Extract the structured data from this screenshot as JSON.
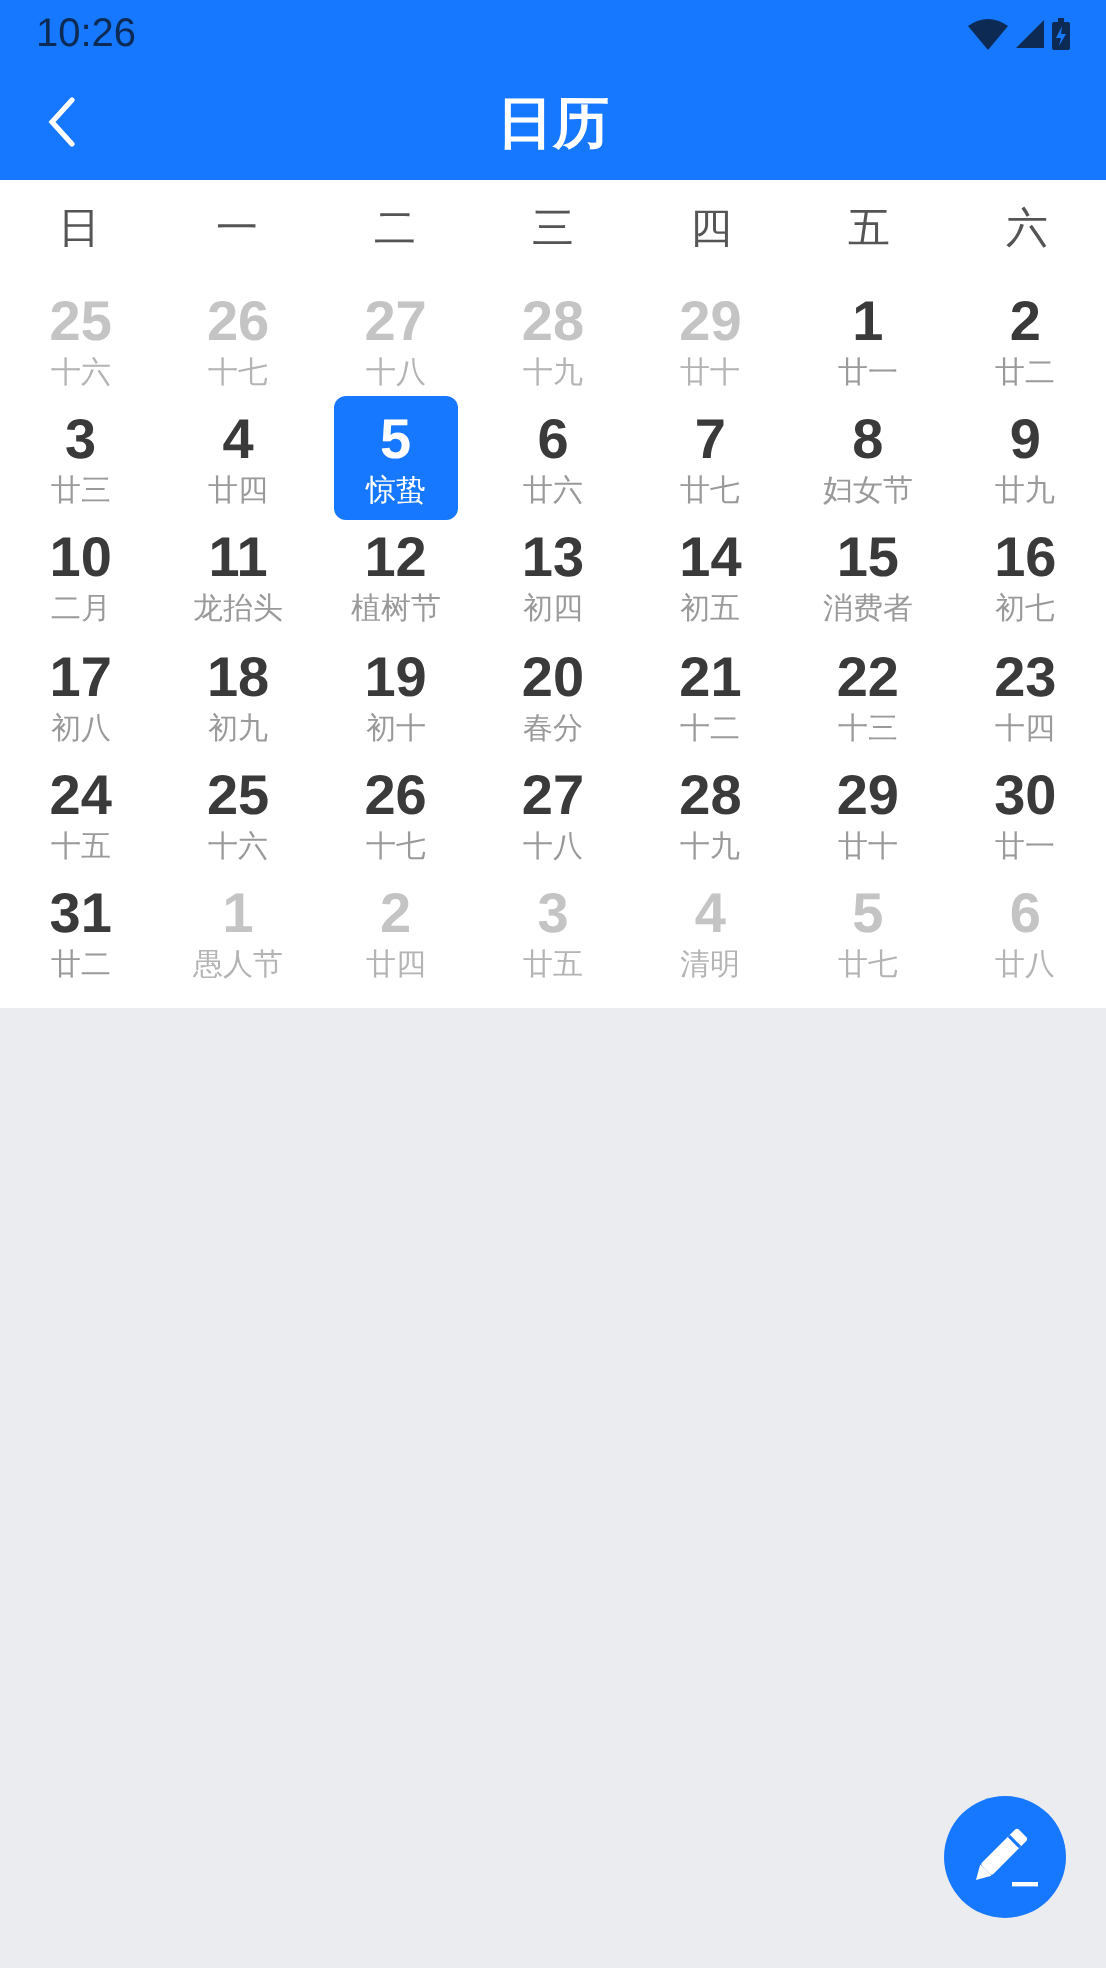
{
  "status_bar": {
    "time": "10:26"
  },
  "app_bar": {
    "title": "日历"
  },
  "weekdays": [
    "日",
    "一",
    "二",
    "三",
    "四",
    "五",
    "六"
  ],
  "days": [
    {
      "day": "25",
      "lunar": "十六",
      "in_month": false,
      "selected": false
    },
    {
      "day": "26",
      "lunar": "十七",
      "in_month": false,
      "selected": false
    },
    {
      "day": "27",
      "lunar": "十八",
      "in_month": false,
      "selected": false
    },
    {
      "day": "28",
      "lunar": "十九",
      "in_month": false,
      "selected": false
    },
    {
      "day": "29",
      "lunar": "廿十",
      "in_month": false,
      "selected": false
    },
    {
      "day": "1",
      "lunar": "廿一",
      "in_month": true,
      "selected": false
    },
    {
      "day": "2",
      "lunar": "廿二",
      "in_month": true,
      "selected": false
    },
    {
      "day": "3",
      "lunar": "廿三",
      "in_month": true,
      "selected": false
    },
    {
      "day": "4",
      "lunar": "廿四",
      "in_month": true,
      "selected": false
    },
    {
      "day": "5",
      "lunar": "惊蛰",
      "in_month": true,
      "selected": true
    },
    {
      "day": "6",
      "lunar": "廿六",
      "in_month": true,
      "selected": false
    },
    {
      "day": "7",
      "lunar": "廿七",
      "in_month": true,
      "selected": false
    },
    {
      "day": "8",
      "lunar": "妇女节",
      "in_month": true,
      "selected": false
    },
    {
      "day": "9",
      "lunar": "廿九",
      "in_month": true,
      "selected": false
    },
    {
      "day": "10",
      "lunar": "二月",
      "in_month": true,
      "selected": false
    },
    {
      "day": "11",
      "lunar": "龙抬头",
      "in_month": true,
      "selected": false
    },
    {
      "day": "12",
      "lunar": "植树节",
      "in_month": true,
      "selected": false
    },
    {
      "day": "13",
      "lunar": "初四",
      "in_month": true,
      "selected": false
    },
    {
      "day": "14",
      "lunar": "初五",
      "in_month": true,
      "selected": false
    },
    {
      "day": "15",
      "lunar": "消费者",
      "in_month": true,
      "selected": false
    },
    {
      "day": "16",
      "lunar": "初七",
      "in_month": true,
      "selected": false
    },
    {
      "day": "17",
      "lunar": "初八",
      "in_month": true,
      "selected": false
    },
    {
      "day": "18",
      "lunar": "初九",
      "in_month": true,
      "selected": false
    },
    {
      "day": "19",
      "lunar": "初十",
      "in_month": true,
      "selected": false
    },
    {
      "day": "20",
      "lunar": "春分",
      "in_month": true,
      "selected": false
    },
    {
      "day": "21",
      "lunar": "十二",
      "in_month": true,
      "selected": false
    },
    {
      "day": "22",
      "lunar": "十三",
      "in_month": true,
      "selected": false
    },
    {
      "day": "23",
      "lunar": "十四",
      "in_month": true,
      "selected": false
    },
    {
      "day": "24",
      "lunar": "十五",
      "in_month": true,
      "selected": false
    },
    {
      "day": "25",
      "lunar": "十六",
      "in_month": true,
      "selected": false
    },
    {
      "day": "26",
      "lunar": "十七",
      "in_month": true,
      "selected": false
    },
    {
      "day": "27",
      "lunar": "十八",
      "in_month": true,
      "selected": false
    },
    {
      "day": "28",
      "lunar": "十九",
      "in_month": true,
      "selected": false
    },
    {
      "day": "29",
      "lunar": "廿十",
      "in_month": true,
      "selected": false
    },
    {
      "day": "30",
      "lunar": "廿一",
      "in_month": true,
      "selected": false
    },
    {
      "day": "31",
      "lunar": "廿二",
      "in_month": true,
      "selected": false
    },
    {
      "day": "1",
      "lunar": "愚人节",
      "in_month": false,
      "selected": false
    },
    {
      "day": "2",
      "lunar": "廿四",
      "in_month": false,
      "selected": false
    },
    {
      "day": "3",
      "lunar": "廿五",
      "in_month": false,
      "selected": false
    },
    {
      "day": "4",
      "lunar": "清明",
      "in_month": false,
      "selected": false
    },
    {
      "day": "5",
      "lunar": "廿七",
      "in_month": false,
      "selected": false
    },
    {
      "day": "6",
      "lunar": "廿八",
      "in_month": false,
      "selected": false
    }
  ]
}
